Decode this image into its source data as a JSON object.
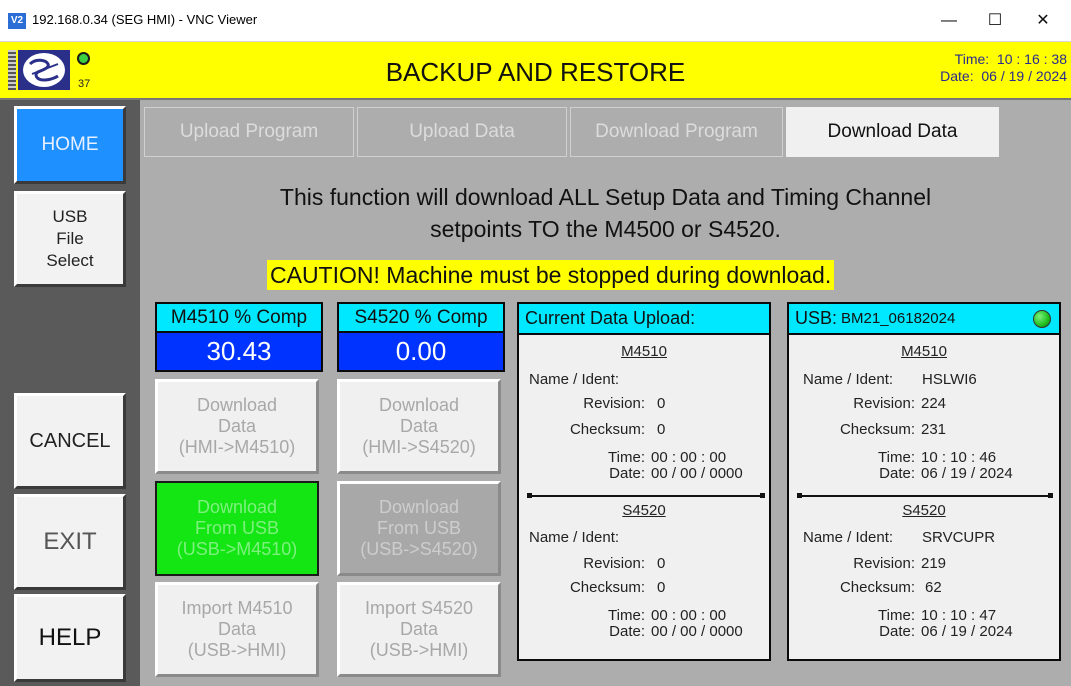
{
  "window": {
    "icon_label": "V2",
    "title": "192.168.0.34 (SEG HMI) - VNC Viewer",
    "minimize": "—",
    "maximize": "☐",
    "close": "✕"
  },
  "header": {
    "status_number": "37",
    "title": "BACKUP AND RESTORE",
    "time": "Time:  10 : 16 : 38",
    "date": "Date:  06 / 19 / 2024",
    "colors": {
      "background": "#ffff00",
      "status_led": "#3cd040"
    }
  },
  "nav": {
    "home": "HOME",
    "usb_file_select": [
      "USB",
      "File",
      "Select"
    ],
    "cancel": "CANCEL",
    "exit": "EXIT",
    "help": "HELP"
  },
  "tabs": [
    {
      "label": "Upload Program",
      "active": false
    },
    {
      "label": "Upload Data",
      "active": false
    },
    {
      "label": "Download Program",
      "active": false
    },
    {
      "label": "Download Data",
      "active": true
    }
  ],
  "info": {
    "line1": "This function will download ALL Setup Data and Timing Channel",
    "line2": "setpoints TO the M4500 or S4520.",
    "caution": "CAUTION! Machine must be stopped during download."
  },
  "comp": {
    "m4510_label": "M4510 % Comp",
    "m4510_value": "30.43",
    "s4520_label": "S4520 % Comp",
    "s4520_value": "0.00"
  },
  "buttons": {
    "download_m4510": [
      "Download",
      "Data",
      "(HMI->M4510)"
    ],
    "download_s4520": [
      "Download",
      "Data",
      "(HMI->S4520)"
    ],
    "usb_m4510": [
      "Download",
      "From USB",
      "(USB->M4510)"
    ],
    "usb_s4520": [
      "Download",
      "From USB",
      "(USB->S4520)"
    ],
    "import_m4510": [
      "Import M4510",
      "Data",
      "(USB->HMI)"
    ],
    "import_s4520": [
      "Import S4520",
      "Data",
      "(USB->HMI)"
    ]
  },
  "current_upload": {
    "header": "Current Data Upload:",
    "m4510": {
      "title": "M4510",
      "name_label": "Name / Ident:",
      "name_value": "",
      "revision_label": "Revision:",
      "revision_value": "0",
      "checksum_label": "Checksum:",
      "checksum_value": "0",
      "time_label": "Time:",
      "time_value": "00 : 00 : 00",
      "date_label": "Date:",
      "date_value": "00 / 00 / 0000"
    },
    "s4520": {
      "title": "S4520",
      "name_label": "Name / Ident:",
      "name_value": "",
      "revision_label": "Revision:",
      "revision_value": "0",
      "checksum_label": "Checksum:",
      "checksum_value": "0",
      "time_label": "Time:",
      "time_value": "00 : 00 : 00",
      "date_label": "Date:",
      "date_value": "00 / 00 / 0000"
    }
  },
  "usb": {
    "header_prefix": "USB:",
    "header_file": "BM21_06182024",
    "led_color": "#1fbf1f",
    "m4510": {
      "title": "M4510",
      "name_label": "Name / Ident:",
      "name_value": "HSLWI6",
      "revision_label": "Revision:",
      "revision_value": "224",
      "checksum_label": "Checksum:",
      "checksum_value": "231",
      "time_label": "Time:",
      "time_value": "10 : 10 : 46",
      "date_label": "Date:",
      "date_value": "06 / 19 / 2024"
    },
    "s4520": {
      "title": "S4520",
      "name_label": "Name / Ident:",
      "name_value": "SRVCUPR",
      "revision_label": "Revision:",
      "revision_value": "219",
      "checksum_label": "Checksum:",
      "checksum_value": "62",
      "time_label": "Time:",
      "time_value": "10 : 10 : 47",
      "date_label": "Date:",
      "date_value": "06 / 19 / 2024"
    }
  }
}
